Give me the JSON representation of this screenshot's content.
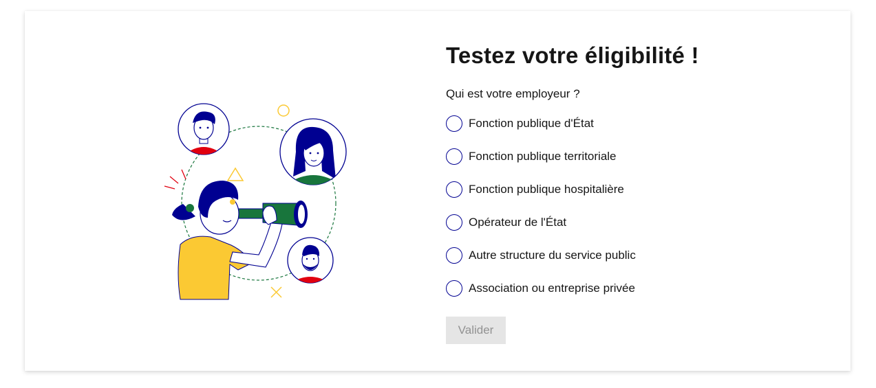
{
  "form": {
    "title": "Testez votre éligibilité !",
    "question": "Qui est votre employeur ?",
    "options": [
      {
        "label": "Fonction publique d'État",
        "selected": false
      },
      {
        "label": "Fonction publique territoriale",
        "selected": false
      },
      {
        "label": "Fonction publique hospitalière",
        "selected": false
      },
      {
        "label": "Opérateur de l'État",
        "selected": false
      },
      {
        "label": "Autre structure du service public",
        "selected": false
      },
      {
        "label": "Association ou entreprise privée",
        "selected": false
      }
    ],
    "submit_label": "Valider",
    "submit_disabled": true
  },
  "colors": {
    "accent": "#000091",
    "text": "#161616",
    "disabled_bg": "#e5e5e5",
    "disabled_text": "#929292",
    "illustration_red": "#e1000f",
    "illustration_green": "#18753c",
    "illustration_yellow": "#fbc933"
  }
}
